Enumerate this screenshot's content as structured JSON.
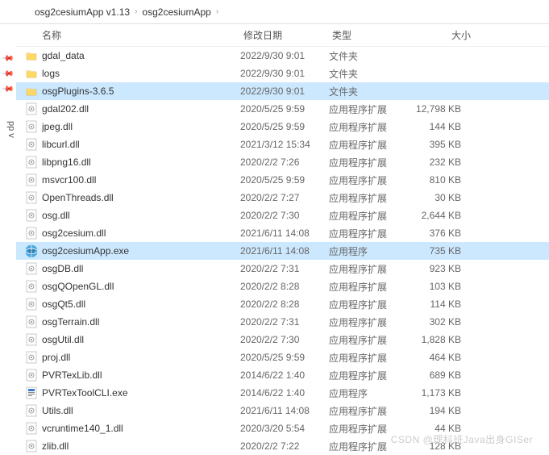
{
  "breadcrumb": {
    "crumb1": "osg2cesiumApp v1.13",
    "crumb2": "osg2cesiumApp"
  },
  "sidebar": {
    "label": "pp v"
  },
  "columns": {
    "name": "名称",
    "date": "修改日期",
    "type": "类型",
    "size": "大小"
  },
  "types": {
    "folder": "文件夹",
    "dll": "应用程序扩展",
    "exe": "应用程序"
  },
  "rows": [
    {
      "icon": "folder",
      "name": "gdal_data",
      "date": "2022/9/30 9:01",
      "type": "文件夹",
      "size": "",
      "selected": false
    },
    {
      "icon": "folder",
      "name": "logs",
      "date": "2022/9/30 9:01",
      "type": "文件夹",
      "size": "",
      "selected": false
    },
    {
      "icon": "folder",
      "name": "osgPlugins-3.6.5",
      "date": "2022/9/30 9:01",
      "type": "文件夹",
      "size": "",
      "selected": true
    },
    {
      "icon": "dll",
      "name": "gdal202.dll",
      "date": "2020/5/25 9:59",
      "type": "应用程序扩展",
      "size": "12,798 KB",
      "selected": false
    },
    {
      "icon": "dll",
      "name": "jpeg.dll",
      "date": "2020/5/25 9:59",
      "type": "应用程序扩展",
      "size": "144 KB",
      "selected": false
    },
    {
      "icon": "dll",
      "name": "libcurl.dll",
      "date": "2021/3/12 15:34",
      "type": "应用程序扩展",
      "size": "395 KB",
      "selected": false
    },
    {
      "icon": "dll",
      "name": "libpng16.dll",
      "date": "2020/2/2 7:26",
      "type": "应用程序扩展",
      "size": "232 KB",
      "selected": false
    },
    {
      "icon": "dll",
      "name": "msvcr100.dll",
      "date": "2020/5/25 9:59",
      "type": "应用程序扩展",
      "size": "810 KB",
      "selected": false
    },
    {
      "icon": "dll",
      "name": "OpenThreads.dll",
      "date": "2020/2/2 7:27",
      "type": "应用程序扩展",
      "size": "30 KB",
      "selected": false
    },
    {
      "icon": "dll",
      "name": "osg.dll",
      "date": "2020/2/2 7:30",
      "type": "应用程序扩展",
      "size": "2,644 KB",
      "selected": false
    },
    {
      "icon": "dll",
      "name": "osg2cesium.dll",
      "date": "2021/6/11 14:08",
      "type": "应用程序扩展",
      "size": "376 KB",
      "selected": false
    },
    {
      "icon": "exe-globe",
      "name": "osg2cesiumApp.exe",
      "date": "2021/6/11 14:08",
      "type": "应用程序",
      "size": "735 KB",
      "selected": true
    },
    {
      "icon": "dll",
      "name": "osgDB.dll",
      "date": "2020/2/2 7:31",
      "type": "应用程序扩展",
      "size": "923 KB",
      "selected": false
    },
    {
      "icon": "dll",
      "name": "osgQOpenGL.dll",
      "date": "2020/2/2 8:28",
      "type": "应用程序扩展",
      "size": "103 KB",
      "selected": false
    },
    {
      "icon": "dll",
      "name": "osgQt5.dll",
      "date": "2020/2/2 8:28",
      "type": "应用程序扩展",
      "size": "114 KB",
      "selected": false
    },
    {
      "icon": "dll",
      "name": "osgTerrain.dll",
      "date": "2020/2/2 7:31",
      "type": "应用程序扩展",
      "size": "302 KB",
      "selected": false
    },
    {
      "icon": "dll",
      "name": "osgUtil.dll",
      "date": "2020/2/2 7:30",
      "type": "应用程序扩展",
      "size": "1,828 KB",
      "selected": false
    },
    {
      "icon": "dll",
      "name": "proj.dll",
      "date": "2020/5/25 9:59",
      "type": "应用程序扩展",
      "size": "464 KB",
      "selected": false
    },
    {
      "icon": "dll",
      "name": "PVRTexLib.dll",
      "date": "2014/6/22 1:40",
      "type": "应用程序扩展",
      "size": "689 KB",
      "selected": false
    },
    {
      "icon": "exe",
      "name": "PVRTexToolCLI.exe",
      "date": "2014/6/22 1:40",
      "type": "应用程序",
      "size": "1,173 KB",
      "selected": false
    },
    {
      "icon": "dll",
      "name": "Utils.dll",
      "date": "2021/6/11 14:08",
      "type": "应用程序扩展",
      "size": "194 KB",
      "selected": false
    },
    {
      "icon": "dll",
      "name": "vcruntime140_1.dll",
      "date": "2020/3/20 5:54",
      "type": "应用程序扩展",
      "size": "44 KB",
      "selected": false
    },
    {
      "icon": "dll",
      "name": "zlib.dll",
      "date": "2020/2/2 7:22",
      "type": "应用程序扩展",
      "size": "128 KB",
      "selected": false
    }
  ],
  "watermark": "CSDN @理科班Java出身GISer"
}
